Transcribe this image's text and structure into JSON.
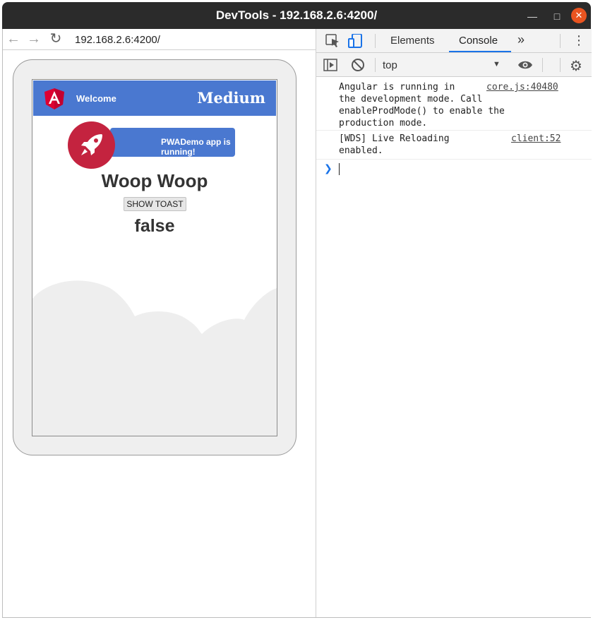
{
  "window": {
    "title": "DevTools - 192.168.2.6:4200/"
  },
  "browser": {
    "url": "192.168.2.6:4200/"
  },
  "app": {
    "toolbar_welcome": "Welcome",
    "toolbar_brand": "Medium",
    "card_text": "PWADemo app is running!",
    "heading": "Woop Woop",
    "toast_button": "SHOW TOAST",
    "status_value": "false"
  },
  "devtools": {
    "tabs": [
      "Elements",
      "Console"
    ],
    "active_tab": "Console",
    "context": "top",
    "messages": [
      {
        "text": "Angular is running in\nthe development mode. Call\nenableProdMode() to enable the\nproduction mode.",
        "source": "core.js:40480"
      },
      {
        "text": "[WDS] Live Reloading\nenabled.",
        "source": "client:52"
      }
    ]
  },
  "colors": {
    "toolbar": "#4a78d0",
    "rocket": "#c4233f",
    "accent": "#1a73e8",
    "close": "#e95420"
  }
}
